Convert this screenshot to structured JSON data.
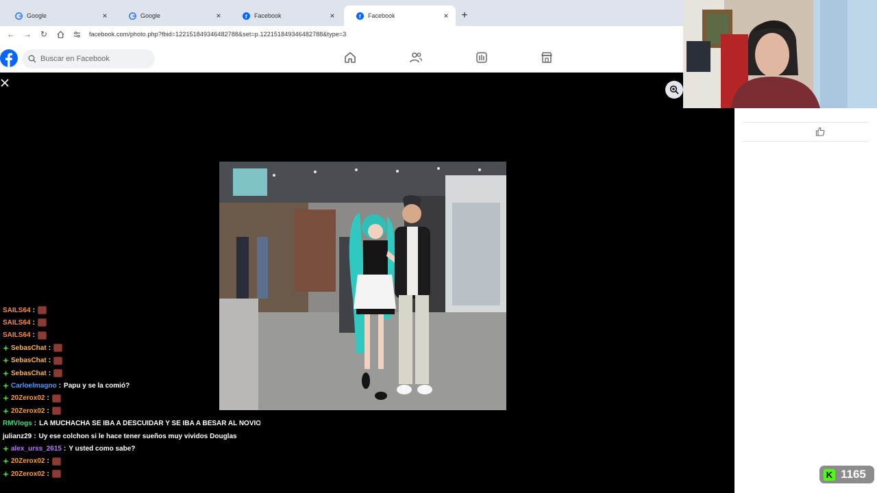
{
  "browser": {
    "tabs": [
      {
        "title": "Google",
        "icon": "google-icon"
      },
      {
        "title": "Google",
        "icon": "google-icon"
      },
      {
        "title": "Facebook",
        "icon": "facebook-icon"
      },
      {
        "title": "Facebook",
        "icon": "facebook-icon",
        "active": true
      }
    ],
    "url": "facebook.com/photo.php?fbid=122151849346482788&set=p.122151849346482788&type=3"
  },
  "facebook": {
    "search_placeholder": "Buscar en Facebook",
    "nav_icons": [
      "home-icon",
      "friends-icon",
      "video-icon",
      "marketplace-icon"
    ],
    "brand_color": "#0866ff"
  },
  "chat": {
    "lines": [
      {
        "user": "SAILS64",
        "color": "#ff8c3a",
        "badge": false,
        "text": "",
        "emote": true
      },
      {
        "user": "SAILS64",
        "color": "#ff8c3a",
        "badge": false,
        "text": "",
        "emote": true
      },
      {
        "user": "SAILS64",
        "color": "#ff8c3a",
        "badge": false,
        "text": "",
        "emote": true
      },
      {
        "user": "SebasChat",
        "color": "#ffb347",
        "badge": true,
        "text": "",
        "emote": true
      },
      {
        "user": "SebasChat",
        "color": "#ffb347",
        "badge": true,
        "text": "",
        "emote": true
      },
      {
        "user": "SebasChat",
        "color": "#ffb347",
        "badge": true,
        "text": "",
        "emote": true
      },
      {
        "user": "Carloelmagno",
        "color": "#4a9cff",
        "badge": true,
        "text": "Papu y se la comió?",
        "emote": false
      },
      {
        "user": "20Zerox02",
        "color": "#ff9f2e",
        "badge": true,
        "text": "",
        "emote": true
      },
      {
        "user": "20Zerox02",
        "color": "#ff9f2e",
        "badge": true,
        "text": "",
        "emote": true
      },
      {
        "user": "RMVlogs",
        "color": "#3ddc84",
        "badge": false,
        "text": "LA MUCHACHA SE IBA A DESCUIDAR Y SE IBA A BESAR AL NOVIO",
        "emote": false
      },
      {
        "user": "julianz29",
        "color": "#ffffff",
        "badge": false,
        "text": "Uy ese colchon si le hace tener sueños muy vividos Douglas",
        "emote": false
      },
      {
        "user": "alex_urss_2615",
        "color": "#b57cff",
        "badge": true,
        "text": "Y usted como sabe?",
        "emote": false
      },
      {
        "user": "20Zerox02",
        "color": "#ff9f2e",
        "badge": true,
        "text": "",
        "emote": true
      },
      {
        "user": "20Zerox02",
        "color": "#ff9f2e",
        "badge": true,
        "text": "",
        "emote": true
      }
    ]
  },
  "kick": {
    "viewer_count": "1165",
    "accent": "#53fc18"
  }
}
